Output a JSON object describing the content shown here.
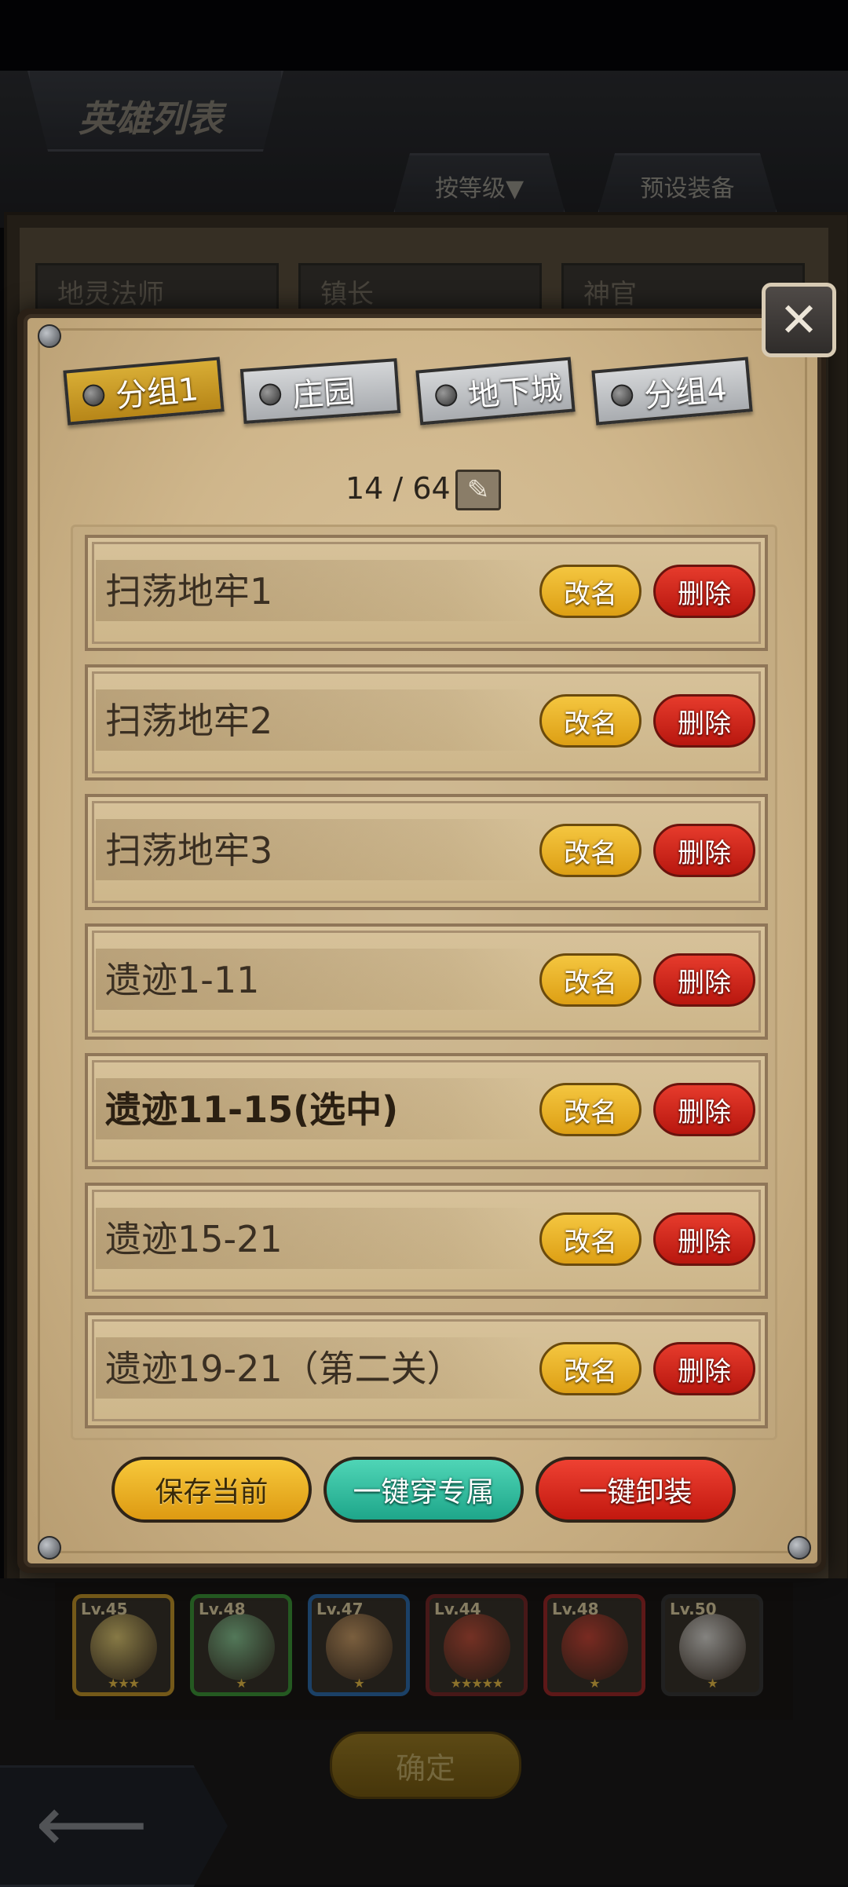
{
  "background": {
    "title": "英雄列表",
    "tabs": [
      "按等级▼",
      "预设装备"
    ],
    "fields": [
      "地灵法师",
      "镇长",
      "神官"
    ],
    "heroes": [
      {
        "level": "Lv.45",
        "stars": "★★★",
        "border": "#c89a2c",
        "face": "#e8d178"
      },
      {
        "level": "Lv.48",
        "stars": "★",
        "border": "#3f9a3a",
        "face": "#8fcf9a"
      },
      {
        "level": "Lv.47",
        "stars": "★",
        "border": "#2f6fb0",
        "face": "#d3a46c"
      },
      {
        "level": "Lv.44",
        "stars": "★★★★★",
        "border": "#7a2a2a",
        "face": "#c8553f"
      },
      {
        "level": "Lv.48",
        "stars": "★",
        "border": "#a02a2a",
        "face": "#d14a3a"
      },
      {
        "level": "Lv.50",
        "stars": "★",
        "border": "#3a3a3a",
        "face": "#e4e2dc"
      }
    ],
    "confirm_label": "确定",
    "back_icon": "⟵"
  },
  "dialog": {
    "close_icon": "✕",
    "group_tabs": [
      "分组1",
      "庄园",
      "地下城",
      "分组4"
    ],
    "active_tab_index": 0,
    "count": "14 / 64",
    "edit_icon": "✎",
    "rows": [
      {
        "label": "扫荡地牢1",
        "selected": false
      },
      {
        "label": "扫荡地牢2",
        "selected": false
      },
      {
        "label": "扫荡地牢3",
        "selected": false
      },
      {
        "label": "遗迹1-11",
        "selected": false
      },
      {
        "label": "遗迹11-15(选中)",
        "selected": true
      },
      {
        "label": "遗迹15-21",
        "selected": false
      },
      {
        "label": "遗迹19-21（第二关）",
        "selected": false
      }
    ],
    "row_rename_label": "改名",
    "row_delete_label": "删除",
    "actions": {
      "save": "保存当前",
      "equip": "一键穿专属",
      "unequip": "一键卸装"
    }
  }
}
